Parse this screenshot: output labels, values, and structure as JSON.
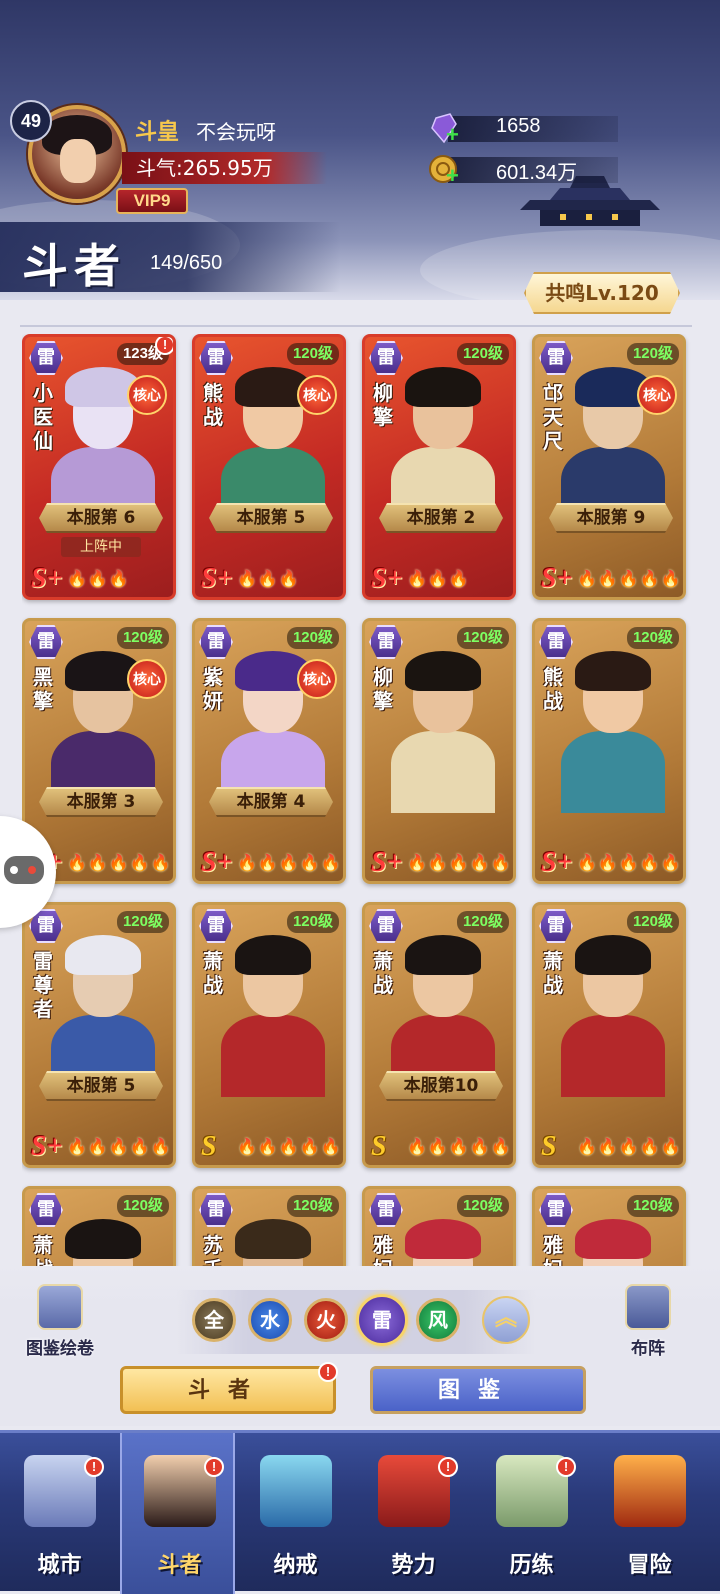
{
  "player": {
    "level": "49",
    "rank": "斗皇",
    "name": "不会玩呀",
    "power": "斗气:265.95万",
    "vip": "VIP9"
  },
  "resources": {
    "gem": "1658",
    "gold": "601.34万"
  },
  "section": {
    "title": "斗者",
    "count": "149/650",
    "resonance": "共鸣Lv.120"
  },
  "cards": [
    {
      "el": "雷",
      "lvl": "123级",
      "name": "小医仙",
      "core": "核心",
      "rank": "本服第 6",
      "deploy": "上阵中",
      "grade": "S+",
      "stars": "🔥🔥🔥",
      "alert": "!",
      "style": "red"
    },
    {
      "el": "雷",
      "lvl": "120级",
      "name": "熊战",
      "core": "核心",
      "rank": "本服第 5",
      "grade": "S+",
      "stars": "🔥🔥🔥",
      "style": "red"
    },
    {
      "el": "雷",
      "lvl": "120级",
      "name": "柳擎",
      "rank": "本服第 2",
      "grade": "S+",
      "stars": "🔥🔥🔥",
      "style": "red"
    },
    {
      "el": "雷",
      "lvl": "120级",
      "name": "邙天尺",
      "core": "核心",
      "rank": "本服第 9",
      "grade": "S+",
      "stars": "🔥🔥🔥🔥🔥",
      "style": "gold"
    },
    {
      "el": "雷",
      "lvl": "120级",
      "name": "黑擎",
      "core": "核心",
      "rank": "本服第 3",
      "grade": "S+",
      "stars": "🔥🔥🔥🔥🔥",
      "style": "gold"
    },
    {
      "el": "雷",
      "lvl": "120级",
      "name": "紫妍",
      "core": "核心",
      "rank": "本服第 4",
      "grade": "S+",
      "stars": "🔥🔥🔥🔥🔥",
      "style": "gold"
    },
    {
      "el": "雷",
      "lvl": "120级",
      "name": "柳擎",
      "grade": "S+",
      "stars": "🔥🔥🔥🔥🔥",
      "style": "gold"
    },
    {
      "el": "雷",
      "lvl": "120级",
      "name": "熊战",
      "grade": "S+",
      "stars": "🔥🔥🔥🔥🔥",
      "style": "gold"
    },
    {
      "el": "雷",
      "lvl": "120级",
      "name": "雷尊者",
      "rank": "本服第 5",
      "grade": "S+",
      "stars": "🔥🔥🔥🔥🔥",
      "style": "gold"
    },
    {
      "el": "雷",
      "lvl": "120级",
      "name": "萧战",
      "grade": "S",
      "stars": "🔥🔥🔥🔥🔥",
      "style": "gold"
    },
    {
      "el": "雷",
      "lvl": "120级",
      "name": "萧战",
      "rank": "本服第10",
      "grade": "S",
      "stars": "🔥🔥🔥🔥🔥",
      "style": "gold"
    },
    {
      "el": "雷",
      "lvl": "120级",
      "name": "萧战",
      "grade": "S",
      "stars": "🔥🔥🔥🔥🔥",
      "style": "gold"
    },
    {
      "el": "雷",
      "lvl": "120级",
      "name": "萧战",
      "style": "gold"
    },
    {
      "el": "雷",
      "lvl": "120级",
      "name": "苏千",
      "style": "gold"
    },
    {
      "el": "雷",
      "lvl": "120级",
      "name": "雅妃",
      "style": "gold"
    },
    {
      "el": "雷",
      "lvl": "120级",
      "name": "雅妃",
      "style": "gold"
    }
  ],
  "filters": {
    "left_label": "图鉴绘卷",
    "right_label": "布阵",
    "elements": [
      "全",
      "水",
      "火",
      "雷",
      "风"
    ],
    "selected": "雷",
    "collapse_icon": "double-chevron-up-icon"
  },
  "tabs": {
    "heroes": "斗者",
    "codex": "图鉴",
    "heroes_alert": "!"
  },
  "nav": [
    {
      "label": "城市",
      "icon": "city-icon",
      "alert": "!"
    },
    {
      "label": "斗者",
      "icon": "hero-icon",
      "alert": "!"
    },
    {
      "label": "纳戒",
      "icon": "ring-icon"
    },
    {
      "label": "势力",
      "icon": "faction-icon",
      "alert": "!"
    },
    {
      "label": "历练",
      "icon": "training-map-icon",
      "alert": "!"
    },
    {
      "label": "冒险",
      "icon": "adventure-icon"
    }
  ],
  "colors": {
    "accent_gold": "#d9a24a",
    "level_green": "#7dff62",
    "alert_red": "#e23a2a",
    "nav_blue": "#2a3a7a"
  }
}
